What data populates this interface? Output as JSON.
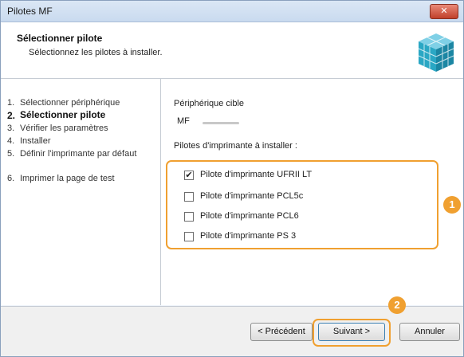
{
  "window": {
    "title": "Pilotes MF",
    "close_symbol": "✕"
  },
  "header": {
    "title": "Sélectionner pilote",
    "subtitle": "Sélectionnez les pilotes à installer."
  },
  "steps": [
    {
      "num": "1.",
      "label": "Sélectionner périphérique",
      "active": false
    },
    {
      "num": "2.",
      "label": "Sélectionner pilote",
      "active": true
    },
    {
      "num": "3.",
      "label": "Vérifier les paramètres",
      "active": false
    },
    {
      "num": "4.",
      "label": "Installer",
      "active": false
    },
    {
      "num": "5.",
      "label": "Définir l'imprimante par défaut",
      "active": false
    },
    {
      "num": "6.",
      "label": "Imprimer la page de test",
      "active": false
    }
  ],
  "main": {
    "device_label": "Périphérique cible",
    "device_name": "MF",
    "drivers_label": "Pilotes d'imprimante à installer :",
    "drivers": [
      {
        "label": "Pilote d'imprimante UFRII LT",
        "checked": true,
        "mark": "✔"
      },
      {
        "label": "Pilote d'imprimante PCL5c",
        "checked": false,
        "mark": ""
      },
      {
        "label": "Pilote d'imprimante PCL6",
        "checked": false,
        "mark": ""
      },
      {
        "label": "Pilote d'imprimante PS 3",
        "checked": false,
        "mark": ""
      }
    ]
  },
  "callouts": {
    "first": "1",
    "second": "2"
  },
  "footer": {
    "back_label": "< Précédent",
    "next_label": "Suivant >",
    "cancel_label": "Annuler"
  },
  "colors": {
    "accent": "#f0a030",
    "icon_teal": "#2aa7c4"
  }
}
